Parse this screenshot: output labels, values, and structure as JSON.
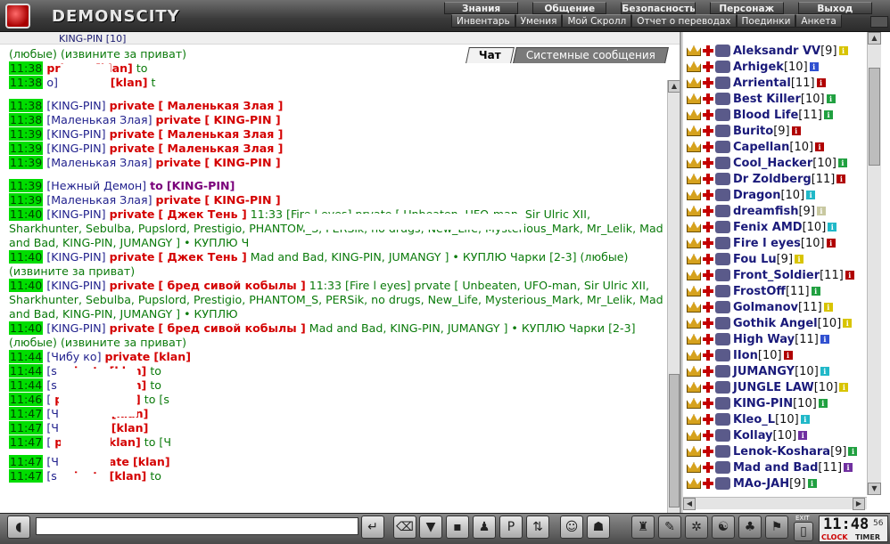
{
  "app": {
    "brand": "DEMONSCITY"
  },
  "nav_top": [
    "Знания",
    "Общение",
    "Безопасность",
    "Персонаж",
    "Выход"
  ],
  "nav_sub": [
    "Инвентарь",
    "Умения",
    "Мой Скролл",
    "Отчет о переводах",
    "Поединки",
    "Анкета"
  ],
  "chat_strip": "KING-PIN [10]",
  "tabs": [
    "Чат",
    "Системные сообщения"
  ],
  "chat": [
    {
      "t": "",
      "who": "",
      "kind": "plain",
      "tail": "(любые) (извините за приват)"
    },
    {
      "t": "11:38",
      "who": "",
      "kind": "priv",
      "target": "[klan]",
      "tail": "to"
    },
    {
      "t": "11:38",
      "who": "o]",
      "kind": "priv",
      "target": "[klan]",
      "tail": "t"
    },
    {
      "t": "11:38",
      "who": "[KING-PIN]",
      "kind": "priv",
      "target": "[ Маленькая Злая ]",
      "tail": ""
    },
    {
      "t": "11:38",
      "who": "[Маленькая Злая]",
      "kind": "priv",
      "target": "[ KING-PIN ]",
      "tail": ""
    },
    {
      "t": "11:39",
      "who": "[KING-PIN]",
      "kind": "priv",
      "target": "[ Маленькая Злая ]",
      "tail": ""
    },
    {
      "t": "11:39",
      "who": "[KING-PIN]",
      "kind": "priv",
      "target": "[ Маленькая Злая ]",
      "tail": ""
    },
    {
      "t": "11:39",
      "who": "[Маленькая Злая]",
      "kind": "priv",
      "target": "[ KING-PIN ]",
      "tail": ""
    },
    {
      "t": "11:39",
      "who": "[Нежный Демон]",
      "kind": "to",
      "target": "[KING-PIN]",
      "tail": ""
    },
    {
      "t": "11:39",
      "who": "[Маленькая Злая]",
      "kind": "priv",
      "target": "[ KING-PIN ]",
      "tail": ""
    },
    {
      "t": "11:40",
      "who": "[KING-PIN]",
      "kind": "priv",
      "target": "[ Джек Тень ]",
      "tail": "11:33 [Fire l eyes] prvate [ Unbeaten, UFO-man, Sir Ulric XII, Sharkhunter, Sebulba, Pupslord, Prestigio, PHANTOM_S, PERSik, no drugs, New_Life, Mysterious_Mark, Mr_Lelik, Mad and Bad, KING-PIN, JUMANGY ] • КУПЛЮ Ч"
    },
    {
      "t": "11:40",
      "who": "[KING-PIN]",
      "kind": "priv",
      "target": "[ Джек Тень ]",
      "tail": "Mad and Bad, KING-PIN, JUMANGY ] • КУПЛЮ Чарки [2-3] (любые) (извините за приват)"
    },
    {
      "t": "11:40",
      "who": "[KING-PIN]",
      "kind": "priv",
      "target": "[ бред сивой кобылы ]",
      "tail": "11:33 [Fire l eyes] prvate [ Unbeaten, UFO-man, Sir Ulric XII, Sharkhunter, Sebulba, Pupslord, Prestigio, PHANTOM_S, PERSik, no drugs, New_Life, Mysterious_Mark, Mr_Lelik, Mad and Bad, KING-PIN, JUMANGY ] • КУПЛЮ"
    },
    {
      "t": "11:40",
      "who": "[KING-PIN]",
      "kind": "priv",
      "target": "[ бред сивой кобылы ]",
      "tail": "Mad and Bad, KING-PIN, JUMANGY ] • КУПЛЮ Чарки [2-3] (любые) (извините за приват)"
    },
    {
      "t": "11:44",
      "who": "[Чибу   ко]",
      "kind": "priv",
      "target": "[klan]",
      "tail": ""
    },
    {
      "t": "11:44",
      "who": "[s",
      "kind": "priv",
      "target": "[klan]",
      "tail": "to"
    },
    {
      "t": "11:44",
      "who": "[s",
      "kind": "priv",
      "target": "[klan]",
      "tail": "to"
    },
    {
      "t": "11:46",
      "who": "[",
      "kind": "priv",
      "target": "[klan]",
      "tail": "to [s"
    },
    {
      "t": "11:47",
      "who": "[Ч",
      "kind": "priv",
      "target": "[klan]",
      "tail": ""
    },
    {
      "t": "11:47",
      "who": "[Ч",
      "kind": "priv",
      "target": "[klan]",
      "tail": ""
    },
    {
      "t": "11:47",
      "who": "[",
      "kind": "priv",
      "target": "[klan]",
      "tail": "to [Ч"
    },
    {
      "t": "11:47",
      "who": "[Ч   ко]",
      "kind": "priv",
      "target": "[klan]",
      "tail": ""
    },
    {
      "t": "11:47",
      "who": "[s",
      "kind": "priv",
      "target": "[klan]",
      "tail": "to"
    }
  ],
  "private_label": "private",
  "to_label": "to",
  "users": [
    {
      "nick": "Aleksandr VV",
      "lvl": "[9]",
      "c": "#d8c400"
    },
    {
      "nick": "Arhigek",
      "lvl": "[10]",
      "c": "#3050d0"
    },
    {
      "nick": "Arriental",
      "lvl": "[11]",
      "c": "#b00000"
    },
    {
      "nick": "Best Killer",
      "lvl": "[10]",
      "c": "#20a040"
    },
    {
      "nick": "Blood Life",
      "lvl": "[11]",
      "c": "#20a040"
    },
    {
      "nick": "Burito",
      "lvl": "[9]",
      "c": "#b00000"
    },
    {
      "nick": "Capellan",
      "lvl": "[10]",
      "c": "#b00000"
    },
    {
      "nick": "Cool_Hacker",
      "lvl": "[10]",
      "c": "#20a040"
    },
    {
      "nick": "Dr Zoldberg",
      "lvl": "[11]",
      "c": "#b00000"
    },
    {
      "nick": "Dragon",
      "lvl": "[10]",
      "c": "#20b8c8"
    },
    {
      "nick": "dreamfish",
      "lvl": "[9]",
      "c": "#c8c8a0"
    },
    {
      "nick": "Fenix AMD",
      "lvl": "[10]",
      "c": "#20b8c8"
    },
    {
      "nick": "Fire l eyes",
      "lvl": "[10]",
      "c": "#b00000"
    },
    {
      "nick": "Fou Lu",
      "lvl": "[9]",
      "c": "#d8c400"
    },
    {
      "nick": "Front_Soldier",
      "lvl": "[11]",
      "c": "#b00000"
    },
    {
      "nick": "FrostOff",
      "lvl": "[11]",
      "c": "#20a040"
    },
    {
      "nick": "Golmanov",
      "lvl": "[11]",
      "c": "#d8c400"
    },
    {
      "nick": "Gothik Angel",
      "lvl": "[10]",
      "c": "#d8c400"
    },
    {
      "nick": "High Way",
      "lvl": "[11]",
      "c": "#3050d0"
    },
    {
      "nick": "IIon",
      "lvl": "[10]",
      "c": "#b00000"
    },
    {
      "nick": "JUMANGY",
      "lvl": "[10]",
      "c": "#20b8c8"
    },
    {
      "nick": "JUNGLE LAW",
      "lvl": "[10]",
      "c": "#d8c400"
    },
    {
      "nick": "KING-PIN",
      "lvl": "[10]",
      "c": "#20a040"
    },
    {
      "nick": "Kleo_L",
      "lvl": "[10]",
      "c": "#20b8c8"
    },
    {
      "nick": "Kollay",
      "lvl": "[10]",
      "c": "#7030a0"
    },
    {
      "nick": "Lenok-Koshara",
      "lvl": "[9]",
      "c": "#20a040"
    },
    {
      "nick": "Mad and Bad",
      "lvl": "[11]",
      "c": "#7030a0"
    },
    {
      "nick": "MAo-JAH",
      "lvl": "[9]",
      "c": "#20a040"
    }
  ],
  "input": {
    "value": ""
  },
  "clock": {
    "time": "11:48",
    "sec": "56",
    "l1": "CLOCK",
    "l2": "TIMER"
  },
  "exit_label": "EXIT"
}
